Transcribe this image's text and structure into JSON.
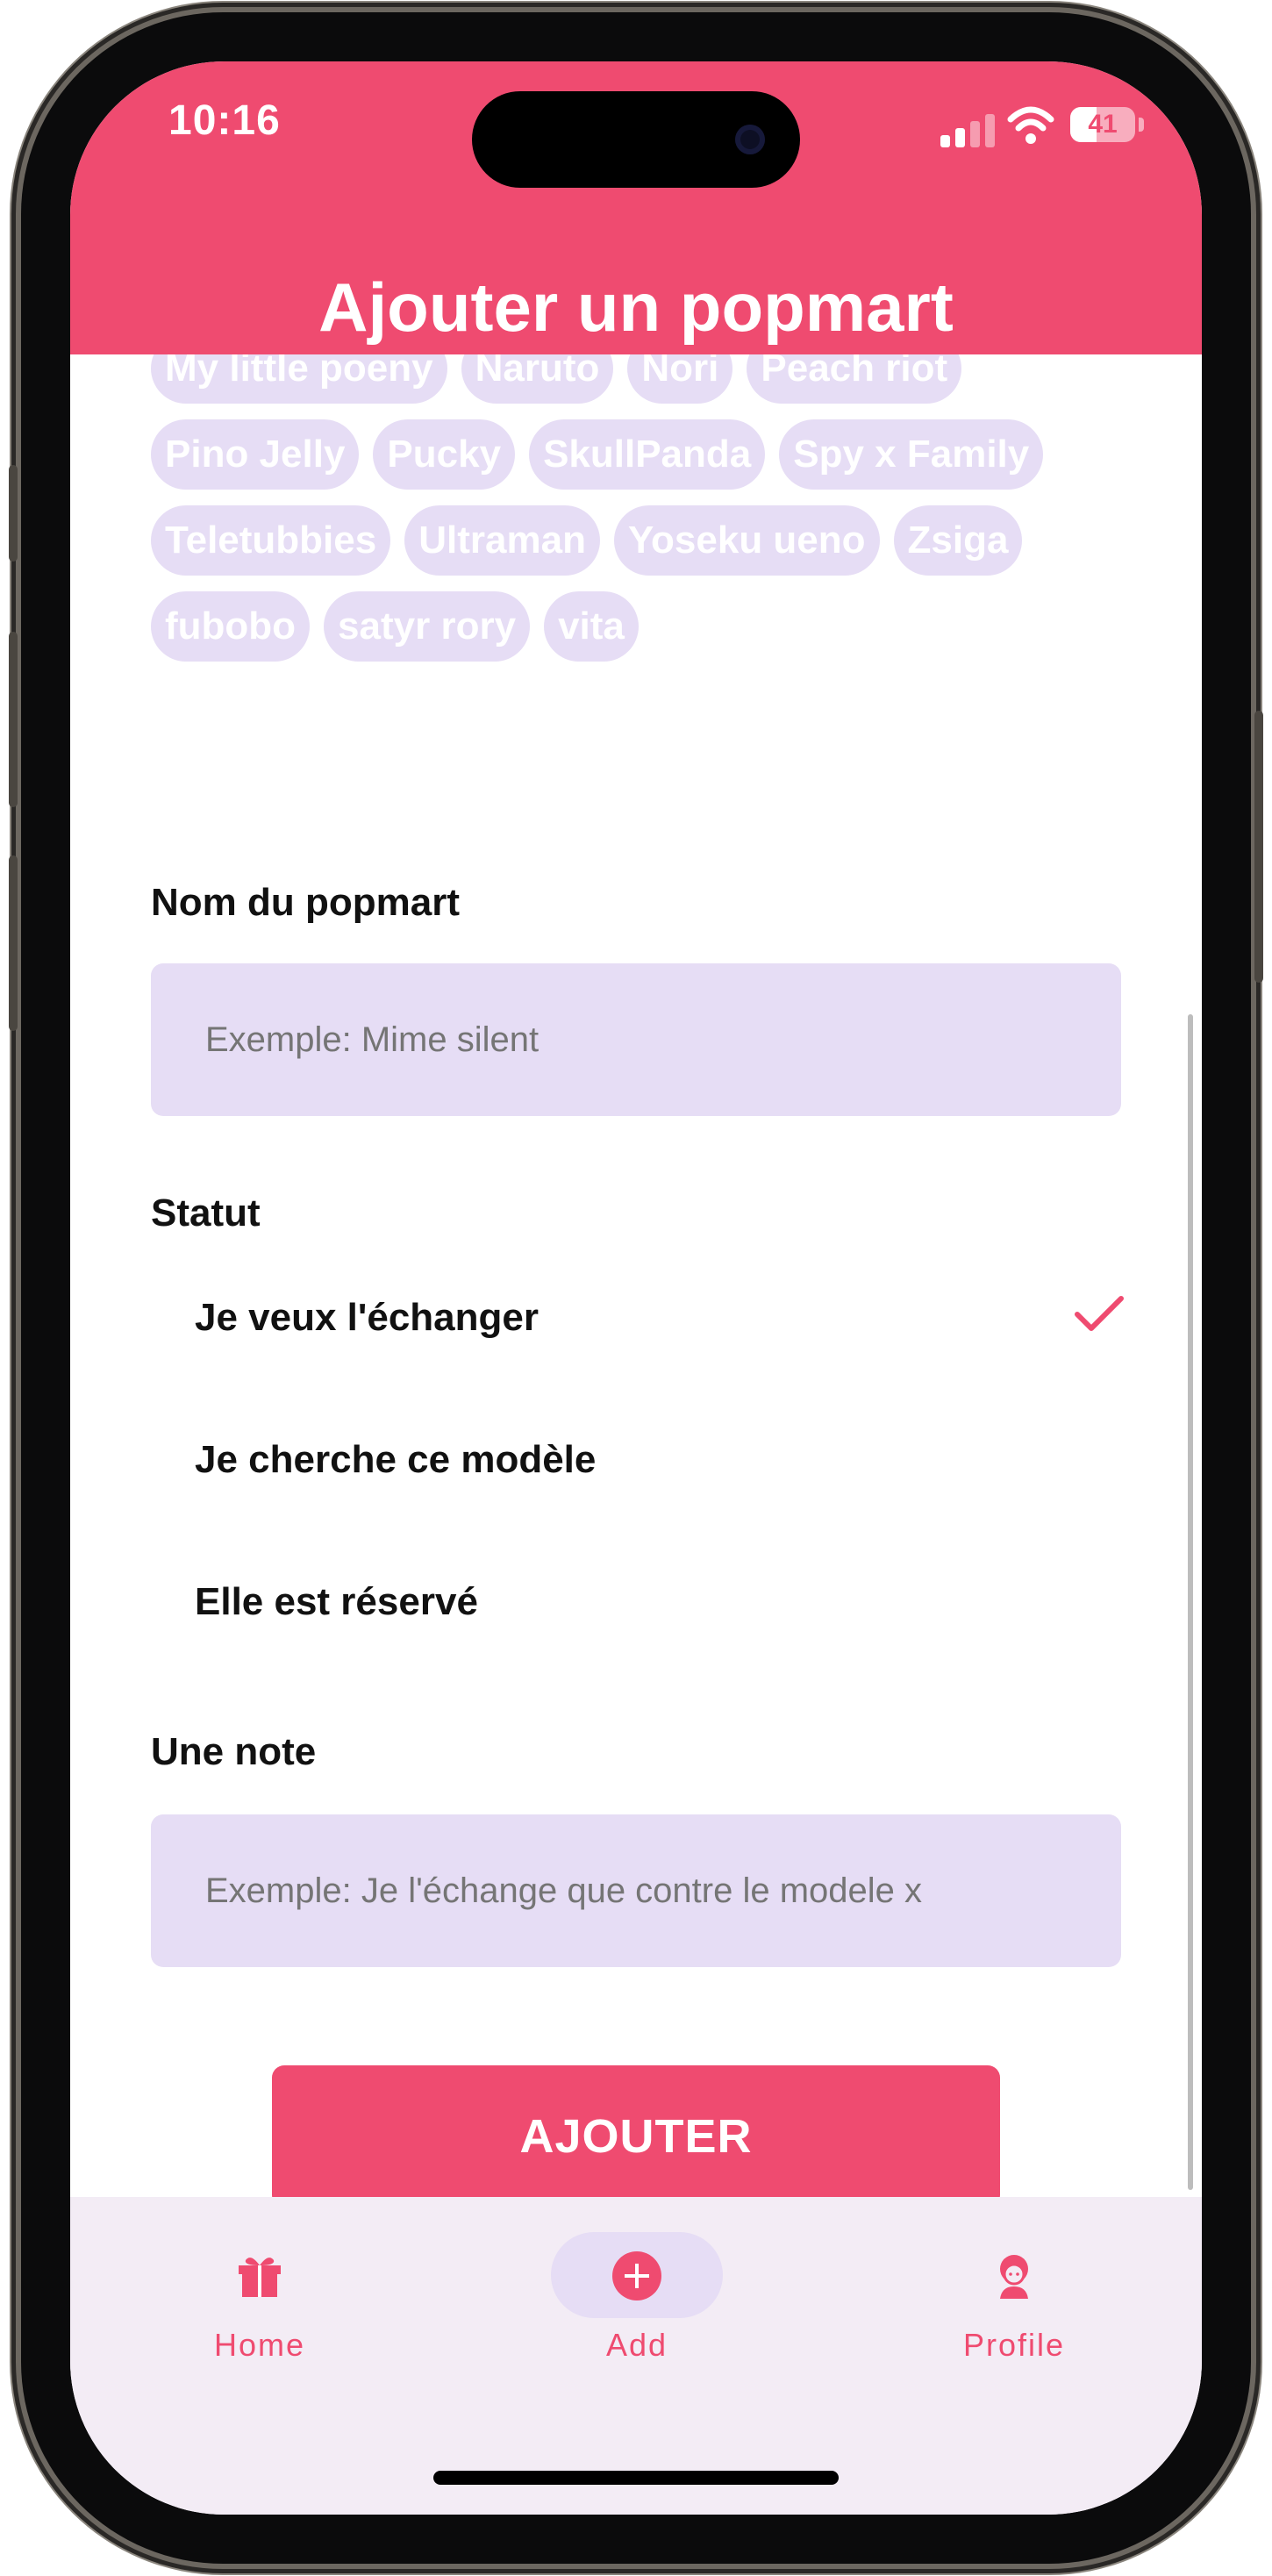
{
  "status_bar": {
    "time": "10:16",
    "battery": "41"
  },
  "header": {
    "title": "Ajouter un popmart"
  },
  "series_chips": [
    "My little poeny",
    "Naruto",
    "Nori",
    "Peach riot",
    "Pino Jelly",
    "Pucky",
    "SkullPanda",
    "Spy x Family",
    "Teletubbies",
    "Ultraman",
    "Yoseku ueno",
    "Zsiga",
    "fubobo",
    "satyr rory",
    "vita"
  ],
  "form": {
    "name_label": "Nom du popmart",
    "name_placeholder": "Exemple: Mime silent",
    "status_label": "Statut",
    "status_options": [
      {
        "label": "Je veux l'échanger",
        "selected": true
      },
      {
        "label": "Je cherche ce modèle",
        "selected": false
      },
      {
        "label": "Elle est réservé",
        "selected": false
      }
    ],
    "note_label": "Une note",
    "note_placeholder": "Exemple: Je l'échange que contre le modele x",
    "submit_label": "AJOUTER"
  },
  "bottom_nav": {
    "items": [
      {
        "label": "Home",
        "icon": "gift-icon",
        "active": false
      },
      {
        "label": "Add",
        "icon": "add-circle-icon",
        "active": true
      },
      {
        "label": "Profile",
        "icon": "person-icon",
        "active": false
      }
    ]
  },
  "colors": {
    "accent": "#ef4b70",
    "chip_bg": "#e6ddf5",
    "nav_bg": "#f3ecf5"
  }
}
